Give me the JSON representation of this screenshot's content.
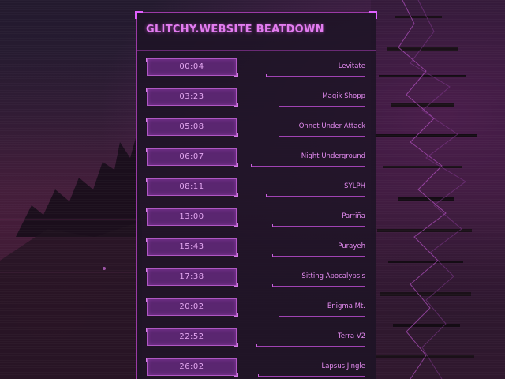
{
  "panel": {
    "title": "GLITCHY.WEBSITE BEATDOWN"
  },
  "tracks": [
    {
      "time": "00:04",
      "name": "Levitate"
    },
    {
      "time": "03:23",
      "name": "Magik Shopp"
    },
    {
      "time": "05:08",
      "name": "Onnet Under Attack"
    },
    {
      "time": "06:07",
      "name": "Night Underground"
    },
    {
      "time": "08:11",
      "name": "SYLPH"
    },
    {
      "time": "13:00",
      "name": "Parriña"
    },
    {
      "time": "15:43",
      "name": "Purayeh"
    },
    {
      "time": "17:38",
      "name": "Sitting Apocalypsis"
    },
    {
      "time": "20:02",
      "name": "Enigma Mt."
    },
    {
      "time": "22:52",
      "name": "Terra V2"
    },
    {
      "time": "26:02",
      "name": "Lapsus Jingle"
    }
  ],
  "colors": {
    "accent": "#e37cf0",
    "panel_border": "#9b3aa6",
    "button_fill": "#5a2670",
    "background": "#231a2e"
  }
}
